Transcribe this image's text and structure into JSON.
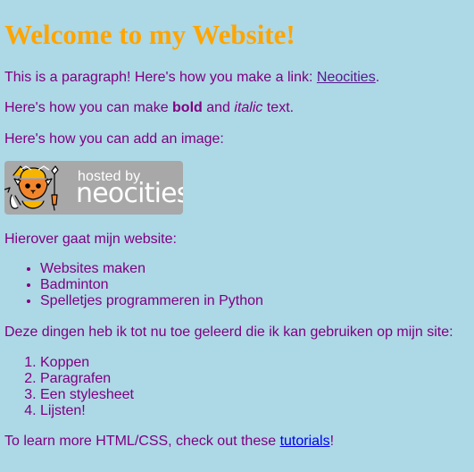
{
  "header": {
    "title": "Welcome to my Website!"
  },
  "intro": {
    "paragraph_prefix": "This is a paragraph! Here's how you make a link: ",
    "link_label": "Neocities",
    "paragraph_suffix": "."
  },
  "bold_line": {
    "prefix": "Here's how you can make ",
    "bold": "bold",
    "middle": " and ",
    "italic": "italic",
    "suffix": " text."
  },
  "image_line": {
    "label": "Here's how you can add an image:",
    "badge": {
      "hosted_label": "hosted by",
      "logo_text": "neocities",
      "mascot_icon": "neocities-cat-icon"
    }
  },
  "website_section": {
    "intro": "Hierover gaat mijn website:",
    "items": [
      "Websites maken",
      "Badminton",
      "Spelletjes programmeren in Python"
    ]
  },
  "learned_section": {
    "intro": "Deze dingen heb ik tot nu toe geleerd die ik kan gebruiken op mijn site:",
    "items": [
      "Koppen",
      "Paragrafen",
      "Een stylesheet",
      "Lijsten!"
    ]
  },
  "footer": {
    "prefix": "To learn more HTML/CSS, check out these ",
    "link_label": "tutorials",
    "suffix": "!"
  },
  "colors": {
    "background": "#add8e6",
    "text": "#800080",
    "heading": "#ffa500",
    "link": "#0000ee",
    "visited_link": "#551a8b",
    "badge_background": "#a8a8a8"
  }
}
